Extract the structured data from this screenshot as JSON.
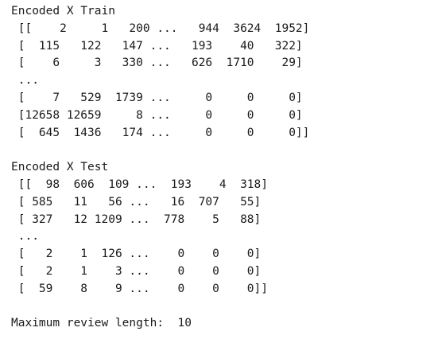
{
  "output": {
    "train": {
      "heading": "Encoded X Train",
      "rows": [
        " [[    2     1   200 ...   944  3624  1952]",
        " [  115   122   147 ...   193    40   322]",
        " [    6     3   330 ...   626  1710    29]",
        " ...",
        " [    7   529  1739 ...     0     0     0]",
        " [12658 12659     8 ...     0     0     0]",
        " [  645  1436   174 ...     0     0     0]]"
      ]
    },
    "test": {
      "heading": "Encoded X Test",
      "rows": [
        " [[  98  606  109 ...  193    4  318]",
        " [ 585   11   56 ...   16  707   55]",
        " [ 327   12 1209 ...  778    5   88]",
        " ...",
        " [   2    1  126 ...    0    0    0]",
        " [   2    1    3 ...    0    0    0]",
        " [  59    8    9 ...    0    0    0]]"
      ]
    },
    "max_length_line": "Maximum review length:  10"
  }
}
